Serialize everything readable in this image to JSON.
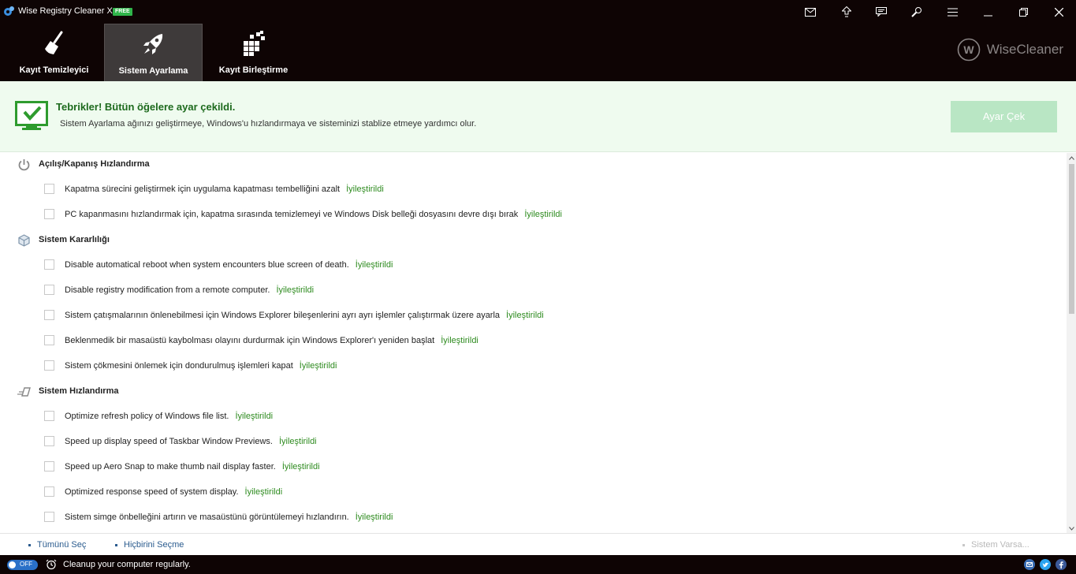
{
  "window": {
    "title": "Wise Registry Cleaner X",
    "badge": "FREE"
  },
  "titlebar_icons": [
    "mail-icon",
    "upgrade-icon",
    "feedback-icon",
    "settings-icon",
    "menu-icon",
    "minimize-icon",
    "maximize-icon",
    "close-icon"
  ],
  "nav": {
    "tabs": [
      {
        "label": "Kayıt Temizleyici",
        "icon": "broom-icon",
        "active": false
      },
      {
        "label": "Sistem Ayarlama",
        "icon": "rocket-icon",
        "active": true
      },
      {
        "label": "Kayıt Birleştirme",
        "icon": "blocks-icon",
        "active": false
      }
    ],
    "brand": "WiseCleaner"
  },
  "banner": {
    "title": "Tebrikler! Bütün öğelere ayar çekildi.",
    "subtitle": "Sistem Ayarlama ağınızı geliştirmeye, Windows'u hızlandırmaya ve sisteminizi stablize etmeye yardımcı olur.",
    "button": "Ayar Çek"
  },
  "sections": [
    {
      "title": "Açılış/Kapanış Hızlandırma",
      "icon": "power-icon",
      "items": [
        {
          "label": "Kapatma sürecini geliştirmek için uygulama kapatması tembelliğini azalt",
          "status": "İyileştirildi",
          "checked": false
        },
        {
          "label": "PC kapanmasını hızlandırmak için, kapatma sırasında temizlemeyi ve Windows Disk belleği dosyasını devre dışı bırak",
          "status": "İyileştirildi",
          "checked": false
        }
      ]
    },
    {
      "title": "Sistem Kararlılığı",
      "icon": "cube-icon",
      "items": [
        {
          "label": "Disable automatical reboot when system encounters blue screen of death.",
          "status": "İyileştirildi",
          "checked": false
        },
        {
          "label": "Disable registry modification from a remote computer.",
          "status": "İyileştirildi",
          "checked": false
        },
        {
          "label": "Sistem çatışmalarının önlenebilmesi için Windows Explorer bileşenlerini ayrı ayrı işlemler çalıştırmak üzere ayarla",
          "status": "İyileştirildi",
          "checked": false
        },
        {
          "label": "Beklenmedik bir masaüstü kaybolması olayını durdurmak için Windows Explorer'ı yeniden başlat",
          "status": "İyileştirildi",
          "checked": false
        },
        {
          "label": "Sistem çökmesini önlemek için dondurulmuş işlemleri kapat",
          "status": "İyileştirildi",
          "checked": false
        }
      ]
    },
    {
      "title": "Sistem Hızlandırma",
      "icon": "speed-icon",
      "items": [
        {
          "label": "Optimize refresh policy of Windows file list.",
          "status": "İyileştirildi",
          "checked": false
        },
        {
          "label": "Speed up display speed of Taskbar Window Previews.",
          "status": "İyileştirildi",
          "checked": false
        },
        {
          "label": "Speed up Aero Snap to make thumb nail display faster.",
          "status": "İyileştirildi",
          "checked": false
        },
        {
          "label": "Optimized response speed of system display.",
          "status": "İyileştirildi",
          "checked": false
        },
        {
          "label": "Sistem simge önbelleğini artırın ve masaüstünü görüntülemeyi hızlandırın.",
          "status": "İyileştirildi",
          "checked": false
        }
      ]
    }
  ],
  "footer": {
    "select_all": "Tümünü Seç",
    "select_none": "Hiçbirini Seçme",
    "system_default": "Sistem Varsa..."
  },
  "statusbar": {
    "toggle_label": "OFF",
    "message": "Cleanup your computer regularly.",
    "social": [
      "email-icon",
      "twitter-icon",
      "facebook-icon"
    ]
  },
  "colors": {
    "dark_bg": "#0e0404",
    "active_tab": "#3e3a3a",
    "success_green": "#1d6a1d",
    "status_green": "#2e8b1f",
    "banner_bg": "#effbef",
    "button_disabled": "#b9e6c4",
    "link_blue": "#2a5b8e"
  }
}
